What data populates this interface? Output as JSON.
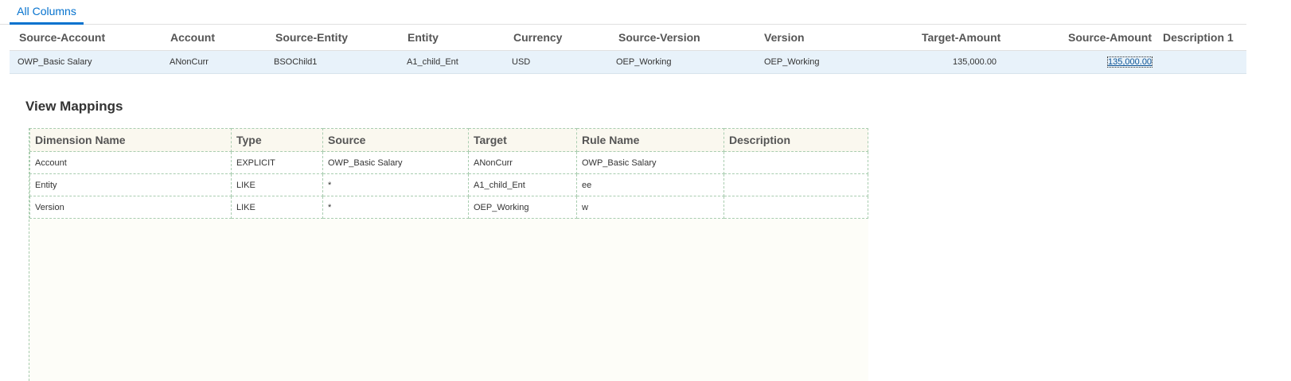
{
  "tabs": [
    "All Columns"
  ],
  "grid": {
    "headers": [
      "Source-Account",
      "Account",
      "Source-Entity",
      "Entity",
      "Currency",
      "Source-Version",
      "Version",
      "Target-Amount",
      "Source-Amount",
      "Description 1"
    ],
    "row": [
      "OWP_Basic Salary",
      "ANonCurr",
      "BSOChild1",
      "A1_child_Ent",
      "USD",
      "OEP_Working",
      "OEP_Working",
      "135,000.00",
      "135,000.00",
      ""
    ]
  },
  "mappings": {
    "title": "View Mappings",
    "headers": [
      "Dimension Name",
      "Type",
      "Source",
      "Target",
      "Rule Name",
      "Description"
    ],
    "rows": [
      [
        "Account",
        "EXPLICIT",
        "OWP_Basic Salary",
        "ANonCurr",
        "OWP_Basic Salary",
        ""
      ],
      [
        "Entity",
        "LIKE",
        "*",
        "A1_child_Ent",
        "ee",
        ""
      ],
      [
        "Version",
        "LIKE",
        "*",
        "OEP_Working",
        "w",
        ""
      ]
    ]
  }
}
